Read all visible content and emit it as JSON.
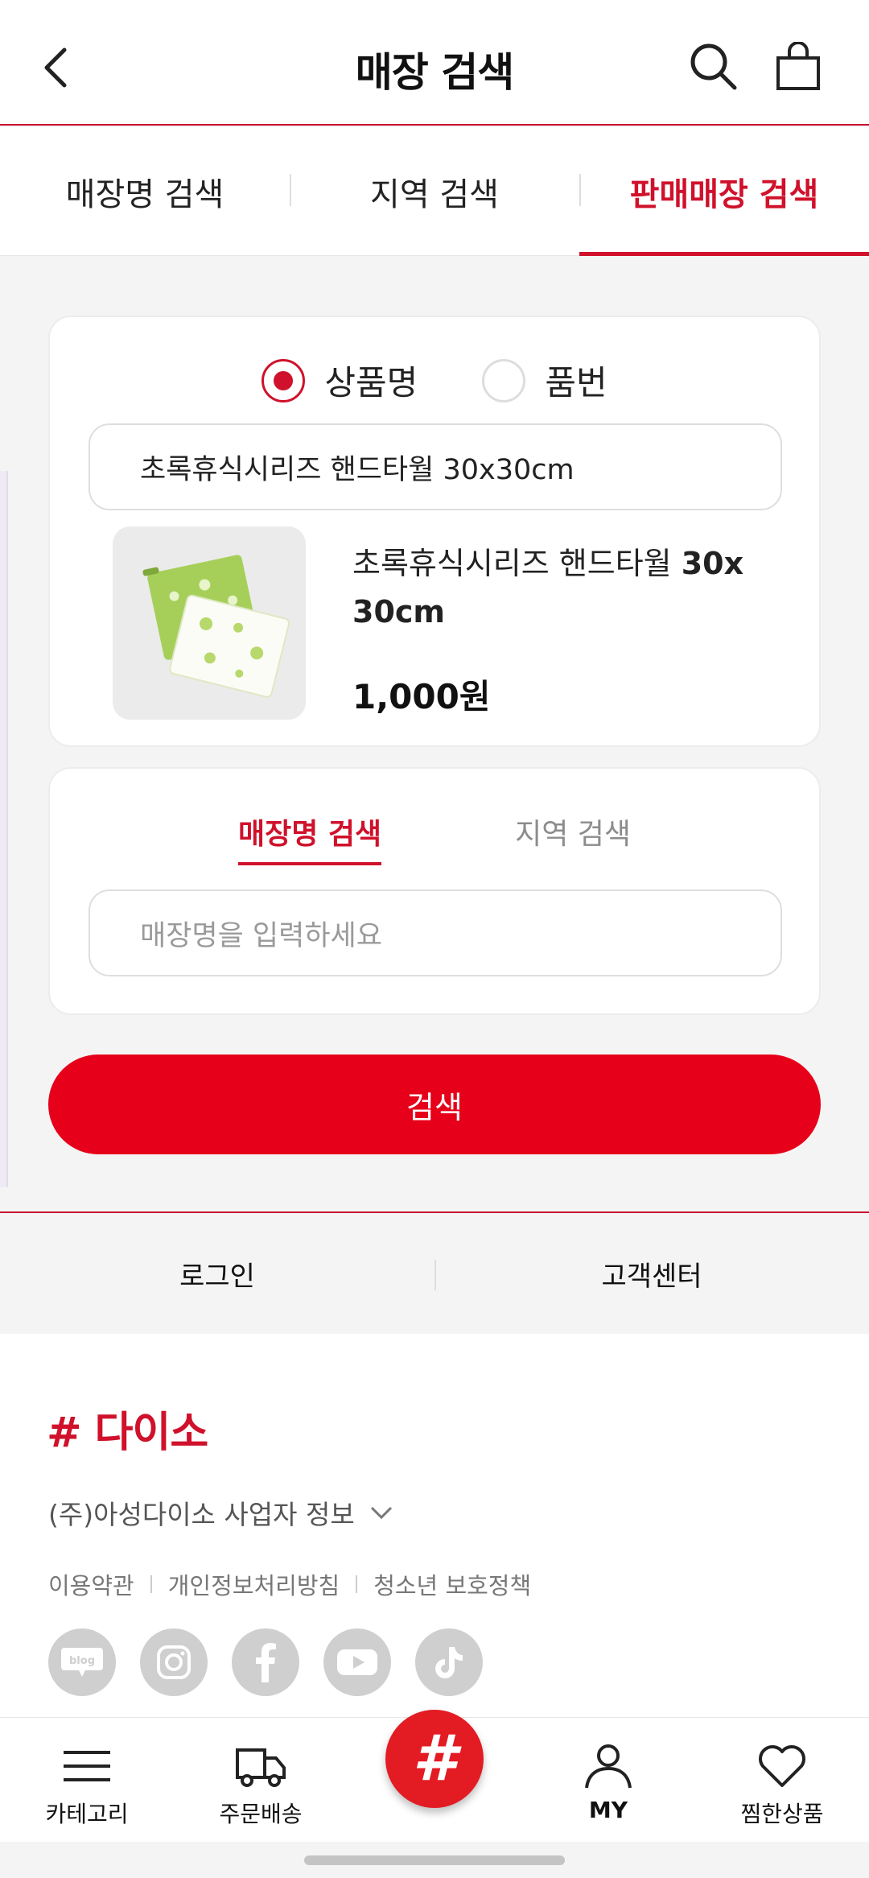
{
  "header": {
    "title": "매장 검색",
    "icons": [
      "back-icon",
      "search-icon",
      "shopping-bag-icon"
    ]
  },
  "tabs": [
    {
      "label": "매장명 검색",
      "active": false
    },
    {
      "label": "지역 검색",
      "active": false
    },
    {
      "label": "판매매장 검색",
      "active": true
    }
  ],
  "product_search": {
    "radio_options": [
      {
        "label": "상품명",
        "selected": true
      },
      {
        "label": "품번",
        "selected": false
      }
    ],
    "query_value": "초록휴식시리즈 핸드타월 30x30cm",
    "product": {
      "name_part1": "초록휴식시리즈 핸드타월 ",
      "name_part2": "30x",
      "name_part3": "30cm",
      "price": "1,000원",
      "image_icon": "hand-towel-image"
    }
  },
  "store_search": {
    "sub_tabs": [
      {
        "label": "매장명 검색",
        "active": true
      },
      {
        "label": "지역 검색",
        "active": false
      }
    ],
    "placeholder": "매장명을 입력하세요"
  },
  "search_button": "검색",
  "footer_links": [
    "로그인",
    "고객센터"
  ],
  "footer": {
    "logo": "# 다이소",
    "company_info": "(주)아성다이소 사업자 정보",
    "policies": [
      "이용약관",
      "개인정보처리방침",
      "청소년 보호정책"
    ],
    "social": [
      "blog-icon",
      "instagram-icon",
      "facebook-icon",
      "youtube-icon",
      "tiktok-icon"
    ],
    "blog_text": "blog"
  },
  "bottom_nav": [
    {
      "label": "카테고리",
      "icon": "menu-icon"
    },
    {
      "label": "주문배송",
      "icon": "truck-icon"
    },
    {
      "label": "",
      "icon": "hash-icon"
    },
    {
      "label": "MY",
      "icon": "person-icon"
    },
    {
      "label": "찜한상품",
      "icon": "heart-icon"
    }
  ],
  "colors": {
    "accent": "#d0112b",
    "button": "#e60019"
  }
}
